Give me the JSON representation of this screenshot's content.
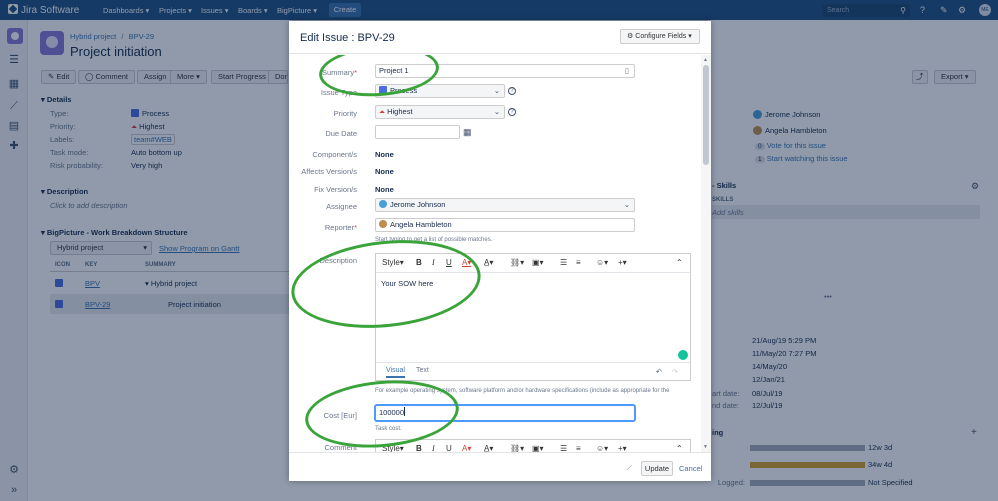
{
  "nav": {
    "logo": "Jira Software",
    "items": [
      "Dashboards ▾",
      "Projects ▾",
      "Issues ▾",
      "Boards ▾",
      "BigPicture ▾"
    ],
    "create": "Create",
    "search_placeholder": "Search",
    "avatar": "ME"
  },
  "page": {
    "breadcrumb_project": "Hybrid project",
    "breadcrumb_sep": "/",
    "breadcrumb_key": "BPV-29",
    "title": "Project initiation",
    "toolbar": [
      "Edit",
      "Comment",
      "Assign",
      "More ▾",
      "Start Progress",
      "Done"
    ],
    "details_title": "Details",
    "details": [
      {
        "label": "Type:",
        "value": "Process"
      },
      {
        "label": "Priority:",
        "value": "Highest"
      },
      {
        "label": "Labels:",
        "value": "team#WEB"
      },
      {
        "label": "Task mode:",
        "value": "Auto bottom up"
      },
      {
        "label": "Risk probability:",
        "value": "Very high"
      }
    ],
    "description_title": "Description",
    "description_placeholder": "Click to add description",
    "wbs_title": "BigPicture - Work Breakdown Structure",
    "wbs_select": "Hybrid project",
    "wbs_link": "Show Program on Gantt",
    "wbs_headers": [
      "ICON",
      "KEY",
      "SUMMARY"
    ],
    "wbs_rows": [
      {
        "key": "BPV",
        "summary": "Hybrid project"
      },
      {
        "key": "BPV-29",
        "summary": "Project initiation"
      }
    ],
    "share": "Export ▾",
    "people": {
      "assignee": "Jerome Johnson",
      "reporter": "Angela Hambleton",
      "votes": "0",
      "vote_link": "Vote for this issue",
      "watchers": "1",
      "watch_link": "Start watching this issue"
    },
    "skills_title": "- Skills",
    "skills_col": "SKILLS",
    "skills_add": "Add skills",
    "dates": [
      "21/Aug/19 5:29 PM",
      "11/May/20 7:27 PM",
      "14/May/20",
      "12/Jan/21",
      "08/Jul/19",
      "12/Jul/19"
    ],
    "date_labels": [
      "art date:",
      "nd date:"
    ],
    "tracking_title": "ing",
    "tracking": [
      {
        "value": "12w 3d",
        "color": "#a5adba"
      },
      {
        "value": "34w 4d",
        "color": "#d7a22b"
      },
      {
        "label": "Logged:",
        "value": "Not Specified",
        "color": "#a5adba"
      }
    ]
  },
  "dialog": {
    "title": "Edit Issue : BPV-29",
    "configure": "Configure Fields ▾",
    "fields": {
      "summary_label": "Summary",
      "summary_value": "Project 1",
      "issue_type_label": "Issue Type",
      "issue_type_value": "Process",
      "priority_label": "Priority",
      "priority_value": "Highest",
      "due_label": "Due Date",
      "components_label": "Component/s",
      "components_value": "None",
      "affects_label": "Affects Version/s",
      "affects_value": "None",
      "fix_label": "Fix Version/s",
      "fix_value": "None",
      "assignee_label": "Assignee",
      "assignee_value": "Jerome Johnson",
      "reporter_label": "Reporter",
      "reporter_value": "Angela Hambleton",
      "reporter_hint": "Start typing to get a list of possible matches.",
      "description_label": "Description",
      "description_value": "Your SOW here",
      "description_hint": "For example operating system, software platform and/or hardware specifications (include as appropriate for the",
      "cost_label": "Cost [Eur]",
      "cost_value": "100000",
      "cost_hint": "Task cost.",
      "comment_label": "Comment"
    },
    "editor": {
      "style": "Style",
      "tab_visual": "Visual",
      "tab_text": "Text"
    },
    "update": "Update",
    "cancel": "Cancel"
  },
  "colors": {
    "nav": "#205081",
    "annotation": "#3aa43a",
    "link": "#3b73af"
  }
}
